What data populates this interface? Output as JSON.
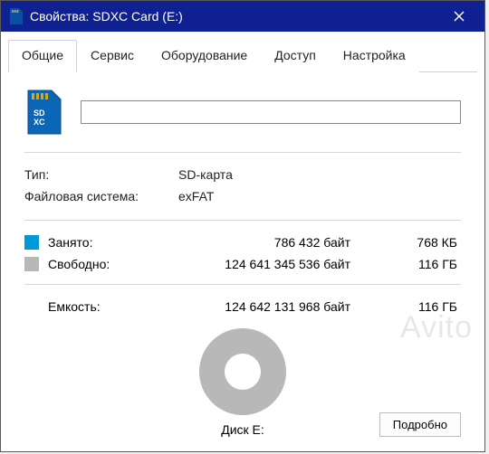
{
  "window": {
    "title": "Свойства: SDXC Card (E:)"
  },
  "tabs": {
    "items": [
      {
        "label": "Общие",
        "active": true
      },
      {
        "label": "Сервис",
        "active": false
      },
      {
        "label": "Оборудование",
        "active": false
      },
      {
        "label": "Доступ",
        "active": false
      },
      {
        "label": "Настройка",
        "active": false
      }
    ]
  },
  "volume": {
    "name_value": "",
    "type_label": "Тип:",
    "type_value": "SD-карта",
    "fs_label": "Файловая система:",
    "fs_value": "exFAT"
  },
  "space": {
    "used": {
      "label": "Занято:",
      "bytes": "786 432 байт",
      "readable": "768 КБ",
      "color": "#0099d8"
    },
    "free": {
      "label": "Свободно:",
      "bytes": "124 641 345 536 байт",
      "readable": "116 ГБ",
      "color": "#b8b8b8"
    },
    "capacity": {
      "label": "Емкость:",
      "bytes": "124 642 131 968 байт",
      "readable": "116 ГБ"
    }
  },
  "disk": {
    "label": "Диск E:"
  },
  "buttons": {
    "details": "Подробно"
  },
  "watermark": "Avito",
  "chart_data": {
    "type": "pie",
    "title": "Диск E:",
    "categories": [
      "Занято",
      "Свободно"
    ],
    "values": [
      786432,
      124641345536
    ],
    "colors": [
      "#0099d8",
      "#b8b8b8"
    ]
  }
}
